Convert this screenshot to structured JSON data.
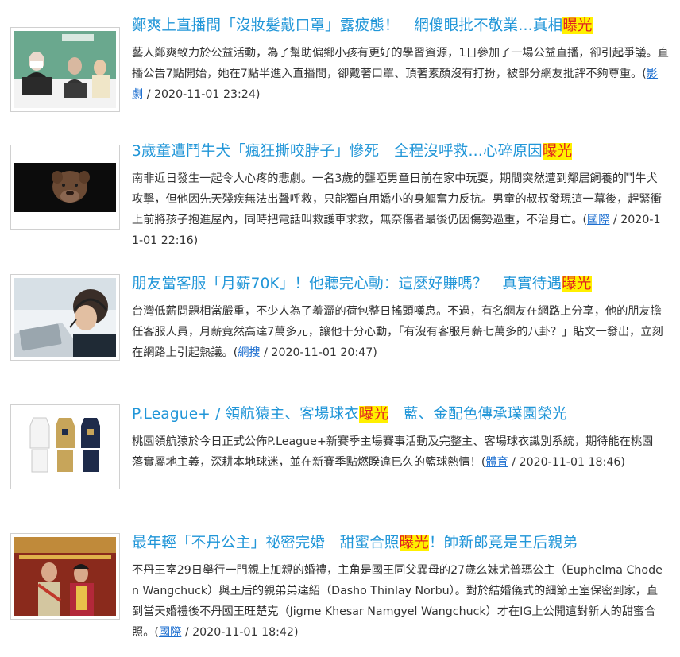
{
  "articles": [
    {
      "title_parts": [
        {
          "text": "鄭爽上直播間「沒妝髮戴口罩」露疲態！　網傻眼批不敬業…真相",
          "highlight": false
        },
        {
          "text": "曝光",
          "highlight": true
        }
      ],
      "summary": "藝人鄭爽致力於公益活動，為了幫助偏鄉小孩有更好的學習資源，1日參加了一場公益直播，卻引起爭議。直播公告7點開始，她在7點半進入直播間，卻戴著口罩、頂著素顏沒有打扮，被部分網友批評不夠尊重。(",
      "category": "影劇",
      "timestamp": " / 2020-11-01 23:24)",
      "thumb_icon": "livestream-photo"
    },
    {
      "title_parts": [
        {
          "text": "3歲童遭鬥牛犬「瘋狂撕咬脖子」慘死　全程沒呼救…心碎原因",
          "highlight": false
        },
        {
          "text": "曝光",
          "highlight": true
        }
      ],
      "summary": "南非近日發生一起令人心疼的悲劇。一名3歲的聾啞男童日前在家中玩耍，期間突然遭到鄰居飼養的鬥牛犬攻擊，但他因先天殘疾無法出聲呼救，只能獨自用嬌小的身軀奮力反抗。男童的叔叔發現這一幕後，趕緊衝上前將孩子抱進屋內，同時把電話叫救護車求救，無奈傷者最後仍因傷勢過重，不治身亡。(",
      "category": "國際",
      "timestamp": " / 2020-11-01 22:16)",
      "thumb_icon": "pitbull-photo"
    },
    {
      "title_parts": [
        {
          "text": "朋友當客服「月薪70K」！他聽完心動：這麼好賺嗎？　真實待遇",
          "highlight": false
        },
        {
          "text": "曝光",
          "highlight": true
        }
      ],
      "summary": "台灣低薪問題相當嚴重，不少人為了羞澀的荷包整日搖頭嘆息。不過，有名網友在網路上分享，他的朋友擔任客服人員，月薪竟然高達7萬多元，讓他十分心動，「有沒有客服月薪七萬多的八卦？」貼文一發出，立刻在網路上引起熱議。(",
      "category": "網搜",
      "timestamp": " / 2020-11-01 20:47)",
      "thumb_icon": "call-center-photo"
    },
    {
      "title_parts": [
        {
          "text": "P.League+ / 領航猿主、客場球衣",
          "highlight": false
        },
        {
          "text": "曝光",
          "highlight": true
        },
        {
          "text": "　藍、金配色傳承璞園榮光",
          "highlight": false
        }
      ],
      "summary": "桃園領航猿於今日正式公佈P.League+新賽季主場賽事活動及完整主、客場球衣識別系統，期待能在桃園落實屬地主義，深耕本地球迷，並在新賽季點燃睽違已久的籃球熱情！(",
      "category": "體育",
      "timestamp": " / 2020-11-01 18:46)",
      "thumb_icon": "jerseys-photo"
    },
    {
      "title_parts": [
        {
          "text": "最年輕「不丹公主」祕密完婚　甜蜜合照",
          "highlight": false
        },
        {
          "text": "曝光",
          "highlight": true
        },
        {
          "text": "！帥新郎竟是王后親弟",
          "highlight": false
        }
      ],
      "summary": "不丹王室29日舉行一門親上加親的婚禮，主角是國王同父異母的27歲么妹尤普瑪公主（Euphelma Choden Wangchuck）與王后的親弟弟達紹（Dasho Thinlay Norbu）。對於結婚儀式的細節王室保密到家，直到當天婚禮後不丹國王旺楚克（Jigme Khesar Namgyel Wangchuck）才在IG上公開這對新人的甜蜜合照。(",
      "category": "國際",
      "timestamp": " / 2020-11-01 18:42)",
      "thumb_icon": "royal-wedding-photo"
    }
  ]
}
